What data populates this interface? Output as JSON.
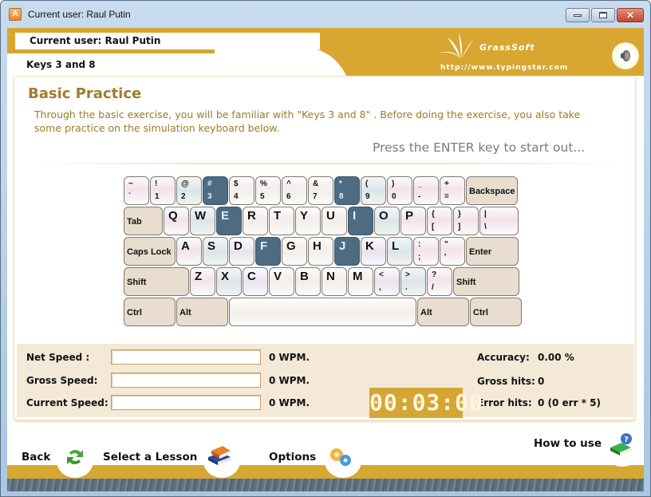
{
  "window": {
    "title": "Current user: Raul Putin",
    "app_icon_letter": "A",
    "controls": {
      "minimize": "minimize",
      "maximize": "maximize",
      "close": "✕"
    }
  },
  "header": {
    "current_user": "Current user: Raul Putin",
    "lesson": "Keys 3 and 8",
    "brand": "GrassSoft",
    "url": "http://www.typingstar.com",
    "sound_icon": "speaker-icon"
  },
  "main": {
    "title": "Basic Practice",
    "description": "Through the basic exercise, you will be familiar with \"Keys 3 and 8\" . Before doing the exercise, you also take some practice on the simulation keyboard below.",
    "hint": "Press the ENTER key to start out..."
  },
  "keyboard": {
    "highlight_color": "#4e6b82",
    "rows": [
      [
        {
          "top": "~",
          "bot": "`",
          "tint": "pink"
        },
        {
          "top": "!",
          "bot": "1",
          "tint": "pink"
        },
        {
          "top": "@",
          "bot": "2",
          "tint": "blue"
        },
        {
          "top": "#",
          "bot": "3",
          "hl": true
        },
        {
          "top": "$",
          "bot": "4"
        },
        {
          "top": "%",
          "bot": "5"
        },
        {
          "top": "^",
          "bot": "6"
        },
        {
          "top": "&",
          "bot": "7"
        },
        {
          "top": "*",
          "bot": "8",
          "hl": true
        },
        {
          "top": "(",
          "bot": "9",
          "tint": "blue"
        },
        {
          "top": ")",
          "bot": "0",
          "tint": "pink"
        },
        {
          "top": "_",
          "bot": "-",
          "tint": "pink"
        },
        {
          "top": "+",
          "bot": "=",
          "tint": "pink"
        },
        {
          "mod": "Backspace"
        }
      ],
      [
        {
          "mod": "Tab"
        },
        {
          "big": "Q",
          "tint": "pink"
        },
        {
          "big": "W",
          "tint": "blue"
        },
        {
          "big": "E",
          "hl": true
        },
        {
          "big": "R"
        },
        {
          "big": "T"
        },
        {
          "big": "Y"
        },
        {
          "big": "U"
        },
        {
          "big": "I",
          "hl": true
        },
        {
          "big": "O",
          "tint": "blue"
        },
        {
          "big": "P",
          "tint": "pink"
        },
        {
          "top": "{",
          "bot": "[",
          "tint": "pink"
        },
        {
          "top": "}",
          "bot": "]",
          "tint": "pink"
        },
        {
          "top": "|",
          "bot": "\\",
          "tint": "pink"
        }
      ],
      [
        {
          "mod": "Caps Lock"
        },
        {
          "big": "A",
          "tint": "pink"
        },
        {
          "big": "S",
          "tint": "blue"
        },
        {
          "big": "D",
          "tint": "purple"
        },
        {
          "big": "F",
          "hl": true
        },
        {
          "big": "G"
        },
        {
          "big": "H"
        },
        {
          "big": "J",
          "hl": true
        },
        {
          "big": "K",
          "tint": "purple"
        },
        {
          "big": "L",
          "tint": "blue"
        },
        {
          "top": ":",
          "bot": ";",
          "tint": "pink"
        },
        {
          "top": "\"",
          "bot": "'",
          "tint": "pink"
        },
        {
          "mod": "Enter"
        }
      ],
      [
        {
          "mod": "Shift"
        },
        {
          "big": "Z",
          "tint": "pink"
        },
        {
          "big": "X",
          "tint": "blue"
        },
        {
          "big": "C",
          "tint": "purple"
        },
        {
          "big": "V"
        },
        {
          "big": "B"
        },
        {
          "big": "N"
        },
        {
          "big": "M"
        },
        {
          "top": "<",
          "bot": ",",
          "tint": "purple"
        },
        {
          "top": ">",
          "bot": ".",
          "tint": "blue"
        },
        {
          "top": "?",
          "bot": "/",
          "tint": "pink"
        },
        {
          "mod": "Shift"
        }
      ],
      [
        {
          "mod": "Ctrl"
        },
        {
          "mod": "Alt"
        },
        {
          "space": ""
        },
        {
          "mod": "Alt"
        },
        {
          "mod": "Ctrl"
        }
      ]
    ]
  },
  "stats": {
    "net_speed_label": "Net Speed  :",
    "net_speed_value": "0 WPM.",
    "gross_speed_label": "Gross Speed:",
    "gross_speed_value": "0 WPM.",
    "current_speed_label": "Current Speed:",
    "current_speed_value": "0 WPM.",
    "accuracy_label": "Accuracy:",
    "accuracy_value": "0.00 %",
    "gross_hits_label": "Gross hits:",
    "gross_hits_value": "0",
    "error_hits_label": "Error hits:",
    "error_hits_value": "0 (0 err * 5)",
    "timer": "00:03:00"
  },
  "nav": {
    "back": "Back",
    "select_lesson": "Select a Lesson",
    "options": "Options",
    "how_to_use": "How to use"
  },
  "colors": {
    "brand_gold": "#d7a731",
    "title_brown": "#a07d2e",
    "stats_bg": "#f3e9d6"
  }
}
